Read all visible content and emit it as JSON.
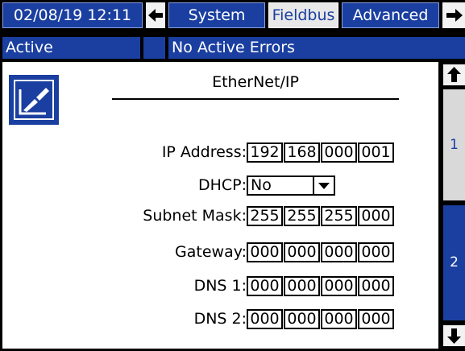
{
  "header": {
    "datetime": "02/08/19 12:11",
    "back_icon": "left-arrow-icon",
    "tabs": [
      {
        "label": "System",
        "selected": false
      },
      {
        "label": "Fieldbus",
        "selected": true
      },
      {
        "label": "Advanced",
        "selected": false
      }
    ],
    "forward_icon": "right-arrow-icon"
  },
  "status": {
    "state": "Active",
    "errors": "No Active Errors"
  },
  "screen": {
    "title": "EtherNet/IP",
    "edit_icon": "edit-icon",
    "fields": {
      "ip_address": {
        "label": "IP Address:",
        "octets": [
          "192",
          "168",
          "000",
          "001"
        ]
      },
      "dhcp": {
        "label": "DHCP:",
        "value": "No"
      },
      "subnet_mask": {
        "label": "Subnet Mask:",
        "octets": [
          "255",
          "255",
          "255",
          "000"
        ]
      },
      "gateway": {
        "label": "Gateway:",
        "octets": [
          "000",
          "000",
          "000",
          "000"
        ]
      },
      "dns1": {
        "label": "DNS 1:",
        "octets": [
          "000",
          "000",
          "000",
          "000"
        ]
      },
      "dns2": {
        "label": "DNS 2:",
        "octets": [
          "000",
          "000",
          "000",
          "000"
        ]
      }
    }
  },
  "pager": {
    "up_icon": "up-arrow-icon",
    "pages": [
      "1",
      "2"
    ],
    "current_page": "1",
    "down_icon": "down-arrow-icon"
  },
  "colors": {
    "accent": "#1a3fa0",
    "selected_tab": "#e8e8e8",
    "background": "#000000",
    "panel": "#ffffff"
  }
}
